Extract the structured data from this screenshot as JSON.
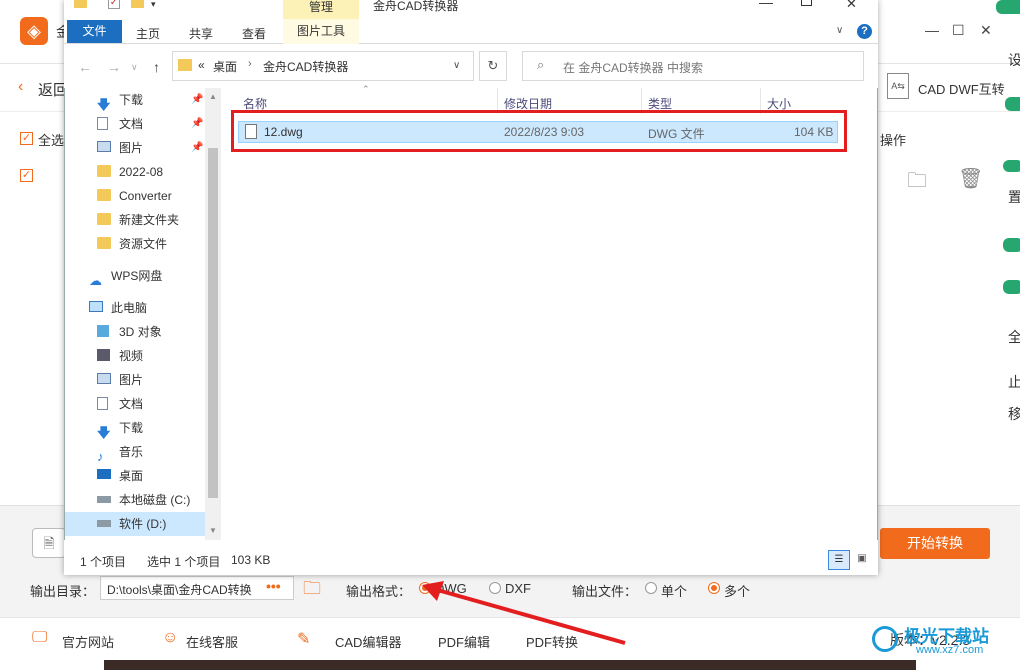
{
  "app": {
    "name": "金",
    "back_label": "返回",
    "cad_dwf_label": "CAD DWF互转",
    "select_all_label": "全选",
    "ops_label": "操作",
    "start_button": "开始转换",
    "output_dir_label": "输出目录：",
    "output_dir_value": "D:\\tools\\桌面\\金舟CAD转换",
    "output_dir_more": "•••",
    "output_format_label": "输出格式：",
    "format_options": [
      "DWG",
      "DXF"
    ],
    "format_selected": "DWG",
    "output_file_label": "输出文件：",
    "file_options": [
      "单个",
      "多个"
    ],
    "file_selected": "多个",
    "footer": [
      "官方网站",
      "在线客服",
      "CAD编辑器",
      "PDF编辑",
      "PDF转换"
    ],
    "version": "版本：v2.2.3",
    "watermark": "极光下载站",
    "watermark_url": "www.xz7.com",
    "right_edge_text": [
      "设",
      "置",
      "全",
      "止",
      "移"
    ]
  },
  "explorer": {
    "title": "金舟CAD转换器",
    "ribbon_context_tab": "管理",
    "ribbon_tabs": [
      "文件",
      "主页",
      "共享",
      "查看",
      "图片工具"
    ],
    "breadcrumb": [
      "«",
      "桌面",
      "金舟CAD转换器"
    ],
    "search_placeholder": "在 金舟CAD转换器 中搜索",
    "nav_items": [
      {
        "label": "下载",
        "icon": "download-arrow-icon",
        "pinned": true
      },
      {
        "label": "文档",
        "icon": "document-icon",
        "pinned": true
      },
      {
        "label": "图片",
        "icon": "picture-icon",
        "pinned": true
      },
      {
        "label": "2022-08",
        "icon": "folder-icon",
        "pinned": false
      },
      {
        "label": "Converter",
        "icon": "folder-icon",
        "pinned": false
      },
      {
        "label": "新建文件夹",
        "icon": "folder-icon",
        "pinned": false
      },
      {
        "label": "资源文件",
        "icon": "folder-icon",
        "pinned": false
      },
      {
        "label": "WPS网盘",
        "icon": "cloud-icon",
        "pinned": false
      },
      {
        "label": "此电脑",
        "icon": "computer-icon",
        "pinned": false
      },
      {
        "label": "3D 对象",
        "icon": "cube-icon",
        "pinned": false
      },
      {
        "label": "视频",
        "icon": "video-icon",
        "pinned": false
      },
      {
        "label": "图片",
        "icon": "picture-icon",
        "pinned": false
      },
      {
        "label": "文档",
        "icon": "document-icon",
        "pinned": false
      },
      {
        "label": "下载",
        "icon": "download-arrow-icon",
        "pinned": false
      },
      {
        "label": "音乐",
        "icon": "music-note-icon",
        "pinned": false
      },
      {
        "label": "桌面",
        "icon": "desktop-icon",
        "pinned": false
      },
      {
        "label": "本地磁盘 (C:)",
        "icon": "drive-icon",
        "pinned": false
      },
      {
        "label": "软件 (D:)",
        "icon": "drive-icon",
        "pinned": false
      }
    ],
    "columns": [
      "名称",
      "修改日期",
      "类型",
      "大小"
    ],
    "files": [
      {
        "name": "12.dwg",
        "date": "2022/8/23 9:03",
        "type": "DWG 文件",
        "size": "104 KB"
      }
    ],
    "status": {
      "count": "1 个项目",
      "selected": "选中 1 个项目",
      "size": "103 KB"
    }
  },
  "colors": {
    "accent": "#f26b1d",
    "highlight_box": "#e21e1e",
    "selection": "#cce8ff",
    "file_tab": "#1c6ec1"
  }
}
